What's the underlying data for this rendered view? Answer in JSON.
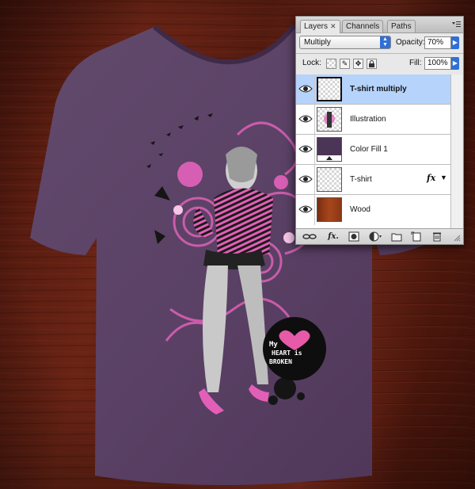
{
  "layers_panel": {
    "tabs": [
      {
        "label": "Layers",
        "close": "✕",
        "active": true
      },
      {
        "label": "Channels",
        "active": false
      },
      {
        "label": "Paths",
        "active": false
      }
    ],
    "blend_mode": "Multiply",
    "opacity_label": "Opacity:",
    "opacity_value": "70%",
    "lock_label": "Lock:",
    "fill_label": "Fill:",
    "fill_value": "100%",
    "layers": [
      {
        "name": "T-shirt multiply",
        "selected": true,
        "visible": true,
        "thumb": "checker-frame"
      },
      {
        "name": "Illustration",
        "selected": false,
        "visible": true,
        "thumb": "figure"
      },
      {
        "name": "Color Fill 1",
        "selected": false,
        "visible": true,
        "thumb": "purple-fill"
      },
      {
        "name": "T-shirt",
        "selected": false,
        "visible": true,
        "thumb": "checker",
        "fx": "fx"
      },
      {
        "name": "Wood",
        "selected": false,
        "visible": true,
        "thumb": "wood"
      }
    ],
    "bottom_icons": [
      "link-layers-icon",
      "fx-icon",
      "add-mask-icon",
      "adjustment-layer-icon",
      "new-group-icon",
      "new-layer-icon",
      "trash-icon"
    ],
    "fx_button_label": "fx."
  },
  "artwork": {
    "logo_line1": "My",
    "logo_line2": "HEART is",
    "logo_line3": "BROKEN",
    "colors": {
      "wood": "#5a1e12",
      "shirt": "#5b4366",
      "pink": "#e070c0",
      "panel_accent": "#2f6fd8",
      "selection": "#b5d3fb"
    }
  }
}
